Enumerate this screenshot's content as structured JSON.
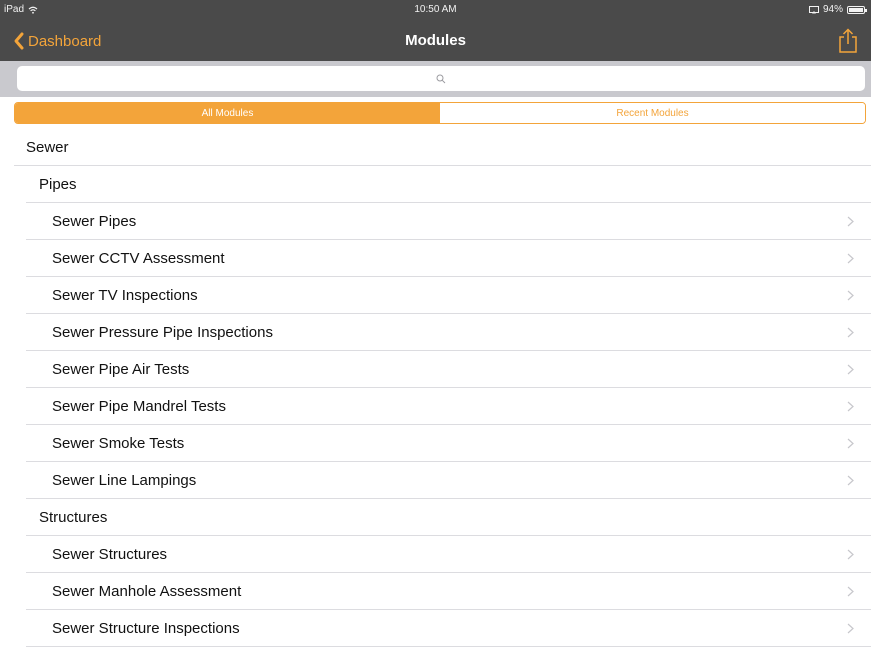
{
  "status": {
    "carrier": "iPad",
    "time": "10:50 AM",
    "battery": "94%"
  },
  "nav": {
    "back_label": "Dashboard",
    "title": "Modules"
  },
  "segments": {
    "all": "All Modules",
    "recent": "Recent Modules"
  },
  "rows": [
    {
      "label": "Sewer",
      "level": 0
    },
    {
      "label": "Pipes",
      "level": 1
    },
    {
      "label": "Sewer Pipes",
      "level": 2
    },
    {
      "label": "Sewer CCTV Assessment",
      "level": 2
    },
    {
      "label": "Sewer TV Inspections",
      "level": 2
    },
    {
      "label": "Sewer Pressure Pipe Inspections",
      "level": 2
    },
    {
      "label": "Sewer Pipe Air Tests",
      "level": 2
    },
    {
      "label": "Sewer Pipe Mandrel Tests",
      "level": 2
    },
    {
      "label": "Sewer Smoke Tests",
      "level": 2
    },
    {
      "label": "Sewer Line Lampings",
      "level": 2
    },
    {
      "label": "Structures",
      "level": 1
    },
    {
      "label": "Sewer Structures",
      "level": 2
    },
    {
      "label": "Sewer Manhole Assessment",
      "level": 2
    },
    {
      "label": "Sewer Structure Inspections",
      "level": 2
    }
  ],
  "colors": {
    "accent": "#f3a43a",
    "navbar": "#4a4a4a",
    "searchbar": "#c9c9ce"
  }
}
